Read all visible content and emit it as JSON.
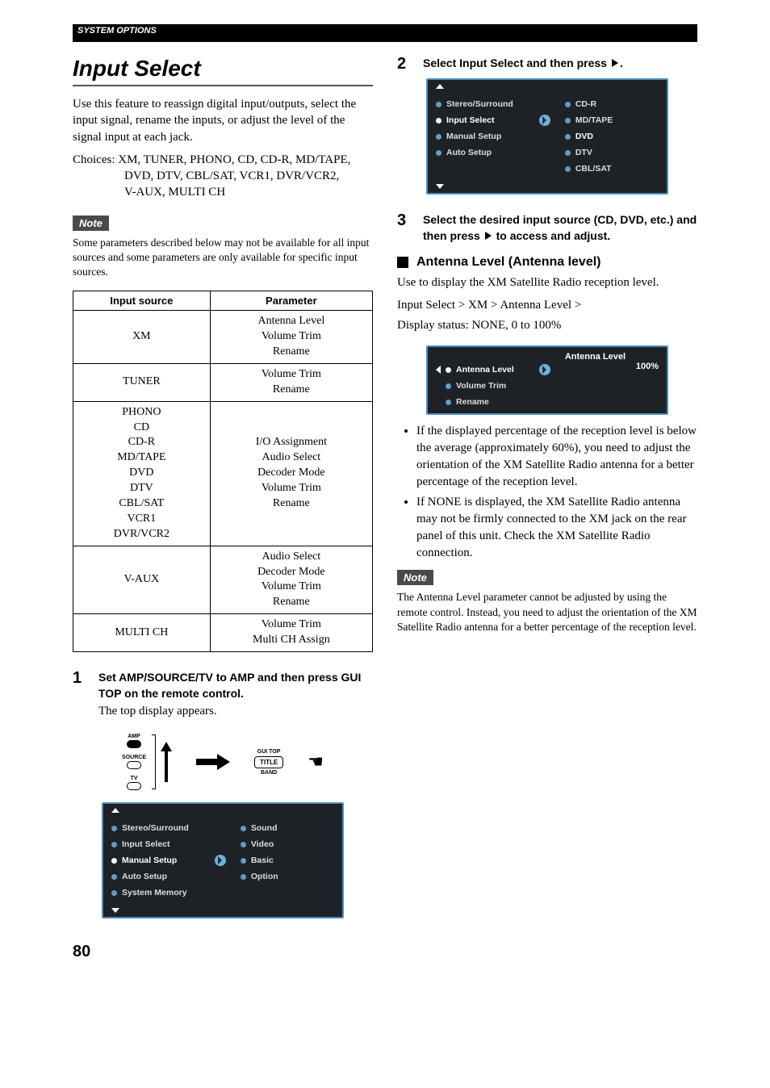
{
  "header": {
    "section_label": "SYSTEM OPTIONS"
  },
  "left": {
    "title": "Input Select",
    "intro": "Use this feature to reassign digital input/outputs, select the input signal, rename the inputs, or adjust the level of the signal input at each jack.",
    "choices_label": "Choices:",
    "choices_line1": "XM, TUNER, PHONO, CD, CD-R, MD/TAPE,",
    "choices_line2": "DVD, DTV, CBL/SAT, VCR1, DVR/VCR2,",
    "choices_line3": "V-AUX, MULTI CH",
    "note_label": "Note",
    "note_text": "Some parameters described below may not be available for all input sources and some parameters are only available for specific input sources.",
    "table": {
      "head_source": "Input source",
      "head_param": "Parameter",
      "rows": [
        {
          "source": "XM",
          "param": "Antenna Level\nVolume Trim\nRename"
        },
        {
          "source": "TUNER",
          "param": "Volume Trim\nRename"
        },
        {
          "source": "PHONO\nCD\nCD-R\nMD/TAPE\nDVD\nDTV\nCBL/SAT\nVCR1\nDVR/VCR2",
          "param": "I/O Assignment\nAudio Select\nDecoder Mode\nVolume Trim\nRename"
        },
        {
          "source": "V-AUX",
          "param": "Audio Select\nDecoder Mode\nVolume Trim\nRename"
        },
        {
          "source": "MULTI CH",
          "param": "Volume Trim\nMulti CH Assign"
        }
      ]
    },
    "step1": {
      "num": "1",
      "title": "Set AMP/SOURCE/TV to AMP and then press GUI TOP on the remote control.",
      "sub": "The top display appears."
    },
    "remote": {
      "amp": "AMP",
      "source": "SOURCE",
      "tv": "TV",
      "gui_top": "GUI TOP",
      "title_btn": "TITLE",
      "band": "BAND"
    },
    "osd1": {
      "left": [
        "Stereo/Surround",
        "Input Select",
        "Manual Setup",
        "Auto Setup",
        "System Memory"
      ],
      "right": [
        "Sound",
        "Video",
        "Basic",
        "Option"
      ],
      "selected_left_index": 2
    }
  },
  "right": {
    "step2": {
      "num": "2",
      "title_pre": "Select Input Select and then press ",
      "title_post": "."
    },
    "osd2": {
      "left": [
        "Stereo/Surround",
        "Input Select",
        "Manual Setup",
        "Auto Setup"
      ],
      "right": [
        "CD-R",
        "MD/TAPE",
        "DVD",
        "DTV",
        "CBL/SAT"
      ],
      "selected_left_index": 1,
      "selected_right_index": 2
    },
    "step3": {
      "num": "3",
      "title_pre": "Select the desired input source (CD, DVD, etc.) and then press ",
      "title_post": " to access and adjust."
    },
    "antenna": {
      "heading": "Antenna Level (Antenna level)",
      "desc": "Use to display the XM Satellite Radio reception level.",
      "path1": "Input Select > XM > Antenna Level >",
      "path2": "Display status: NONE, 0 to 100%"
    },
    "osd3": {
      "left": [
        "Antenna Level",
        "Volume Trim",
        "Rename"
      ],
      "right_title": "Antenna Level",
      "right_value": "100%",
      "selected_left_index": 0
    },
    "bullets": [
      "If the displayed percentage of the reception level is below the average (approximately 60%), you need to adjust the orientation of the XM Satellite Radio antenna for a better percentage of the reception level.",
      "If NONE is displayed, the XM Satellite Radio antenna may not be firmly connected to the XM jack on the rear panel of this unit. Check the XM Satellite Radio connection."
    ],
    "note_label": "Note",
    "note_text": "The Antenna Level parameter cannot be adjusted by using the remote control. Instead, you need to adjust the orientation of the XM Satellite Radio antenna for a better percentage of the reception level."
  },
  "page_number": "80"
}
